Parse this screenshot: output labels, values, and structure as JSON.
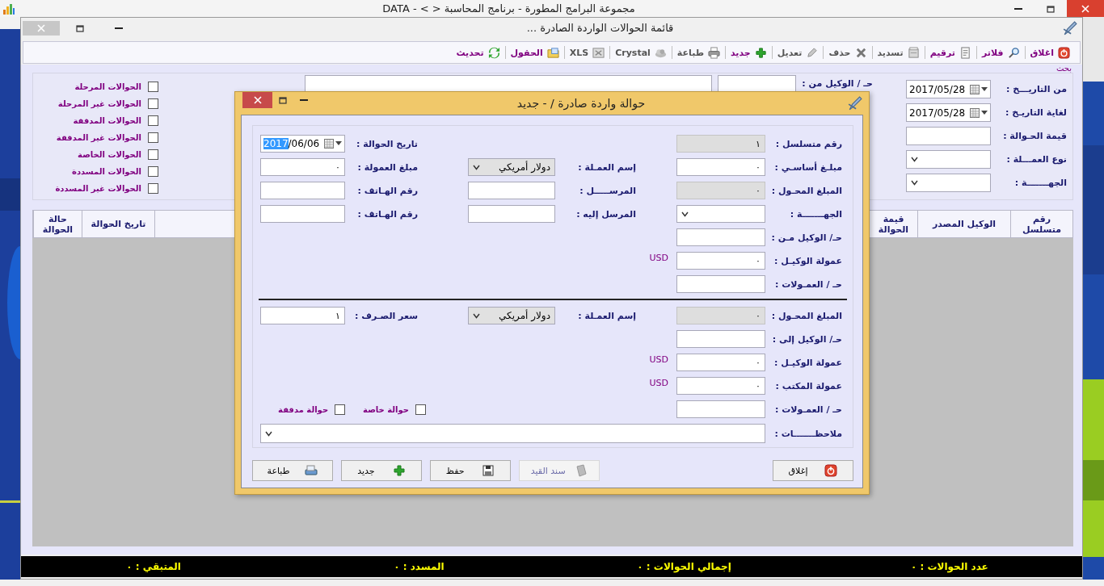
{
  "app": {
    "title": "مجموعة البرامج المطورة - برنامج المحاسبة <  > - DATA"
  },
  "window": {
    "title": "قائمة الحوالات الواردة الصادرة ..."
  },
  "toolbar": [
    {
      "label": "اغلاق",
      "disabled": false
    },
    {
      "label": "فلاتر",
      "disabled": false
    },
    {
      "label": "ترقيم",
      "disabled": false
    },
    {
      "label": "تسديد",
      "disabled": true
    },
    {
      "label": "حذف",
      "disabled": true
    },
    {
      "label": "تعديل",
      "disabled": true
    },
    {
      "label": "جديد",
      "disabled": false
    },
    {
      "label": "طباعة",
      "disabled": true
    },
    {
      "label": "Crystal",
      "disabled": true
    },
    {
      "label": "XLS",
      "disabled": true
    },
    {
      "label": "الحقول",
      "disabled": false
    },
    {
      "label": "تحديث",
      "disabled": false
    }
  ],
  "search": {
    "title": "بحث",
    "fields": [
      {
        "label": "من التاريـــخ :",
        "kind": "date",
        "value": "2017/05/28"
      },
      {
        "label": "لغاية التاريـخ :",
        "kind": "date",
        "value": "2017/05/28"
      },
      {
        "label": "قيمة الحـوالة :",
        "kind": "text"
      },
      {
        "label": "نوع العمـــلة :",
        "kind": "select"
      },
      {
        "label": "الجهـــــــة :",
        "kind": "select"
      }
    ],
    "agent": {
      "label": "حـ / الوكيل من :",
      "kind": "text"
    },
    "filters": [
      {
        "label": "الحوالات المرحلة",
        "checked": false
      },
      {
        "label": "الحوالات غير المرحلة",
        "checked": false
      },
      {
        "label": "الحوالات المدققة",
        "checked": false
      },
      {
        "label": "الحوالات غير المدققة",
        "checked": false
      },
      {
        "label": "الحوالات الخاصة",
        "checked": false
      },
      {
        "label": "الحوالات المسددة",
        "checked": false
      },
      {
        "label": "الحوالات غير المسددة",
        "checked": false
      }
    ]
  },
  "table": {
    "columns": [
      "رقم متسلسل",
      "الوكيل المصدر",
      "قيمة الحوالة",
      "تاريخ الحوالة",
      "حالة الحوالة"
    ]
  },
  "status_bar": [
    "عدد الحوالات : ٠",
    "إجمالي الحوالات : ٠",
    "المسدد : ٠",
    "المتبقي : ٠"
  ],
  "dialog": {
    "title": "حوالة واردة صادرة / - جديد",
    "sections": [
      {
        "rows": [
          {
            "right": {
              "label": "رقم متسلسل :",
              "kind": "text",
              "value": "١",
              "disabled": true
            },
            "left": {
              "label": "تاريخ الحوالة :",
              "kind": "date",
              "selected_text": "2017",
              "value": "/06/06"
            }
          },
          {
            "right": {
              "label": "مبلـغ أساسـي :",
              "kind": "text",
              "value": "٠",
              "disabled": false
            },
            "middle": {
              "label": "إسم العمـلة :",
              "kind": "combo",
              "value": "دولار أمريكي"
            },
            "left": {
              "label": "مبلغ العمولة :",
              "kind": "text",
              "value": "٠",
              "disabled": false
            }
          },
          {
            "right": {
              "label": "المبلغ المحـول :",
              "kind": "text",
              "value": "٠",
              "disabled": true
            },
            "middle": {
              "label": "المرســـــل :",
              "kind": "text",
              "disabled": false
            },
            "left": {
              "label": "رقم الهـاتف :",
              "kind": "text",
              "disabled": false
            }
          },
          {
            "right": {
              "label": "الجهـــــــة :",
              "kind": "select"
            },
            "middle": {
              "label": "المرسل إليه :",
              "kind": "text",
              "disabled": false
            },
            "left": {
              "label": "رقم الهـاتف :",
              "kind": "text",
              "disabled": false
            }
          },
          {
            "right": {
              "label": "حـ/ الوكيل مـن :",
              "kind": "text",
              "disabled": false
            }
          },
          {
            "right": {
              "label": "عمولة الوكيـل :",
              "kind": "text",
              "value": "٠",
              "disabled": false,
              "unit": "USD"
            }
          },
          {
            "right": {
              "label": "حـ / العمـولات :",
              "kind": "text",
              "disabled": false
            }
          }
        ]
      },
      {
        "rows": [
          {
            "right": {
              "label": "المبلغ المحـول :",
              "kind": "text",
              "value": "٠",
              "disabled": true
            },
            "middle": {
              "label": "إسم العمـلة :",
              "kind": "combo",
              "value": "دولار أمريكي"
            },
            "left": {
              "label": "سعر الصـرف :",
              "kind": "text",
              "value": "١",
              "disabled": false
            }
          },
          {
            "right": {
              "label": "حـ/ الوكيل إلى :",
              "kind": "text",
              "disabled": false
            }
          },
          {
            "right": {
              "label": "عمولة الوكيـل :",
              "kind": "text",
              "value": "٠",
              "disabled": false,
              "unit": "USD"
            }
          },
          {
            "right": {
              "label": "عمولة المكتب :",
              "kind": "text",
              "value": "٠",
              "disabled": false,
              "unit": "USD"
            }
          },
          {
            "right": {
              "label": "حـ / العمـولات :",
              "kind": "text",
              "disabled": false
            },
            "checks": [
              {
                "label": "حوالة خاصة",
                "checked": false
              },
              {
                "label": "حوالة مدققة",
                "checked": false
              }
            ]
          }
        ]
      }
    ],
    "notes": {
      "label": "ملاحظـــــــات :",
      "kind": "select"
    },
    "buttons": [
      {
        "label": "إغلاق",
        "disabled": false
      },
      {
        "label": "سند القيد",
        "disabled": true
      },
      {
        "label": "حفظ",
        "disabled": false
      },
      {
        "label": "جديد",
        "disabled": false
      },
      {
        "label": "طباعة",
        "disabled": false
      }
    ]
  }
}
